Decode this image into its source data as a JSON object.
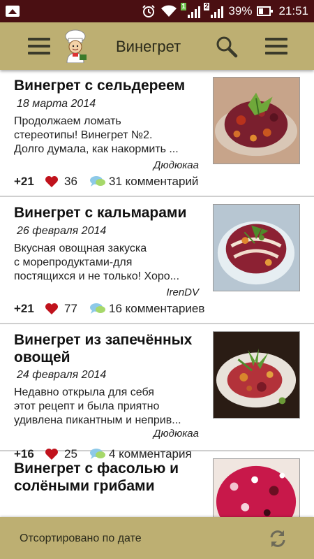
{
  "status_bar": {
    "sim1": "1",
    "sim2": "2",
    "battery": "39%",
    "time": "21:51",
    "icons": [
      "gallery-icon",
      "alarm-icon",
      "wifi-icon",
      "signal-icon",
      "battery-icon"
    ]
  },
  "app_bar": {
    "title": "Винегрет",
    "icons": [
      "hamburger-menu-icon",
      "chef-logo-icon",
      "search-icon",
      "overflow-menu-icon"
    ]
  },
  "recipes": [
    {
      "title": "Винегрет с сельдереем",
      "date": "18 марта 2014",
      "description": [
        "Продолжаем ломать",
        "стереотипы! Винегрет №2.",
        "Долго думала, как накормить ..."
      ],
      "author": "Дюдюкаа",
      "score": "+21",
      "likes": "36",
      "comments": "31 комментарий"
    },
    {
      "title": "Винегрет с кальмарами",
      "date": "26 февраля 2014",
      "description": [
        "Вкусная овощная закуска",
        "с морепродуктами-для",
        "постящихся и не только! Хоро..."
      ],
      "author": "IrenDV",
      "score": "+21",
      "likes": "77",
      "comments": "16 комментариев"
    },
    {
      "title_lines": [
        "Винегрет из запечённых",
        "овощей"
      ],
      "date": "24 февраля 2014",
      "description": [
        "Недавно открыла для себя",
        "этот рецепт и была приятно",
        "удивлена пикантным и неприв..."
      ],
      "author": "Дюдюкаа",
      "score": "+16",
      "likes": "25",
      "comments": "4 комментария"
    },
    {
      "title_lines": [
        "Винегрет с фасолью и",
        "солёными грибами"
      ]
    }
  ],
  "bottom_bar": {
    "sort_label": "Отсортировано по дате",
    "icon": "refresh-icon"
  },
  "colors": {
    "status_bar": "#4a0f12",
    "app_bar": "#bdaf72",
    "heart": "#c0121c",
    "divider": "#cfcfcf"
  }
}
